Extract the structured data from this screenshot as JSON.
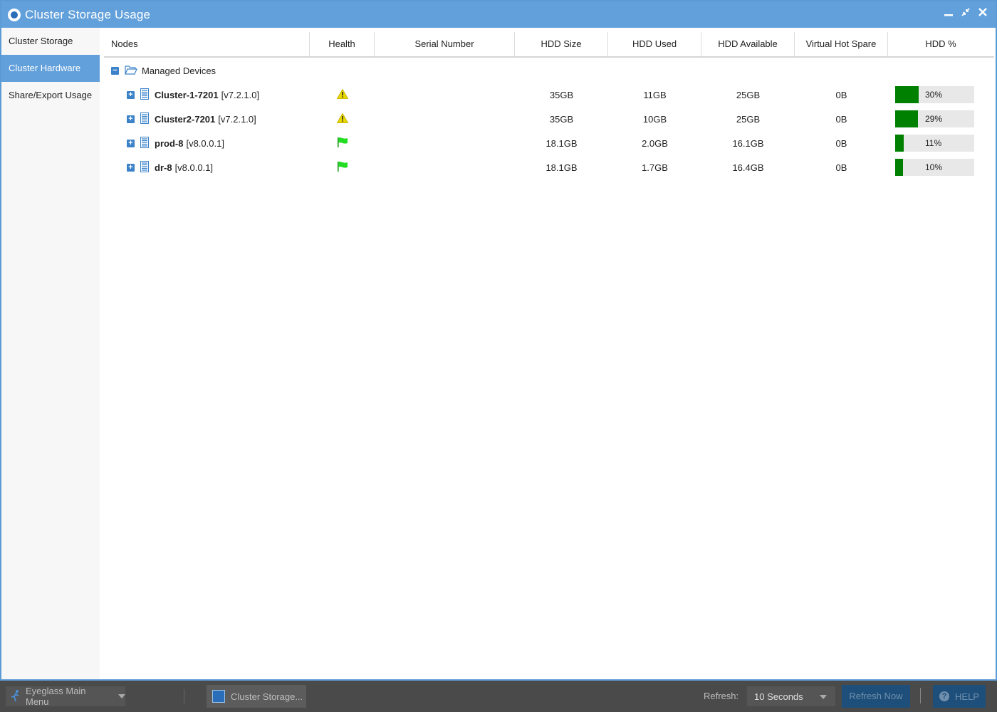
{
  "window": {
    "title": "Cluster Storage Usage"
  },
  "sidebar": {
    "items": [
      {
        "label": "Cluster Storage",
        "active": false
      },
      {
        "label": "Cluster Hardware",
        "active": true
      },
      {
        "label": "Share/Export Usage",
        "active": false
      }
    ]
  },
  "grid": {
    "columns": [
      "Nodes",
      "Health",
      "Serial Number",
      "HDD Size",
      "HDD Used",
      "HDD Available",
      "Virtual Hot Spare",
      "HDD %"
    ],
    "root": {
      "label": "Managed Devices",
      "expanded": true
    },
    "rows": [
      {
        "name": "Cluster-1-7201",
        "version": "[v7.2.1.0]",
        "health": "warning-icon",
        "serial": "",
        "hdd_size": "35GB",
        "hdd_used": "11GB",
        "hdd_available": "25GB",
        "vhs": "0B",
        "hdd_pct_label": "30%",
        "hdd_pct": 30
      },
      {
        "name": "Cluster2-7201",
        "version": "[v7.2.1.0]",
        "health": "warning-icon",
        "serial": "",
        "hdd_size": "35GB",
        "hdd_used": "10GB",
        "hdd_available": "25GB",
        "vhs": "0B",
        "hdd_pct_label": "29%",
        "hdd_pct": 29
      },
      {
        "name": "prod-8",
        "version": "[v8.0.0.1]",
        "health": "ok-flag-icon",
        "serial": "",
        "hdd_size": "18.1GB",
        "hdd_used": "2.0GB",
        "hdd_available": "16.1GB",
        "vhs": "0B",
        "hdd_pct_label": "11%",
        "hdd_pct": 11
      },
      {
        "name": "dr-8",
        "version": "[v8.0.0.1]",
        "health": "ok-flag-icon",
        "serial": "",
        "hdd_size": "18.1GB",
        "hdd_used": "1.7GB",
        "hdd_available": "16.4GB",
        "vhs": "0B",
        "hdd_pct_label": "10%",
        "hdd_pct": 10
      }
    ]
  },
  "taskbar": {
    "main_menu_label": "Eyeglass Main Menu",
    "task_label": "Cluster Storage...",
    "refresh_label": "Refresh:",
    "refresh_value": "10 Seconds",
    "refresh_now_label": "Refresh Now",
    "help_label": "HELP"
  },
  "colors": {
    "titlebar": "#62a0db",
    "bar_fill": "#008000",
    "warning": "#e8d800",
    "ok_flag": "#22dd22"
  }
}
